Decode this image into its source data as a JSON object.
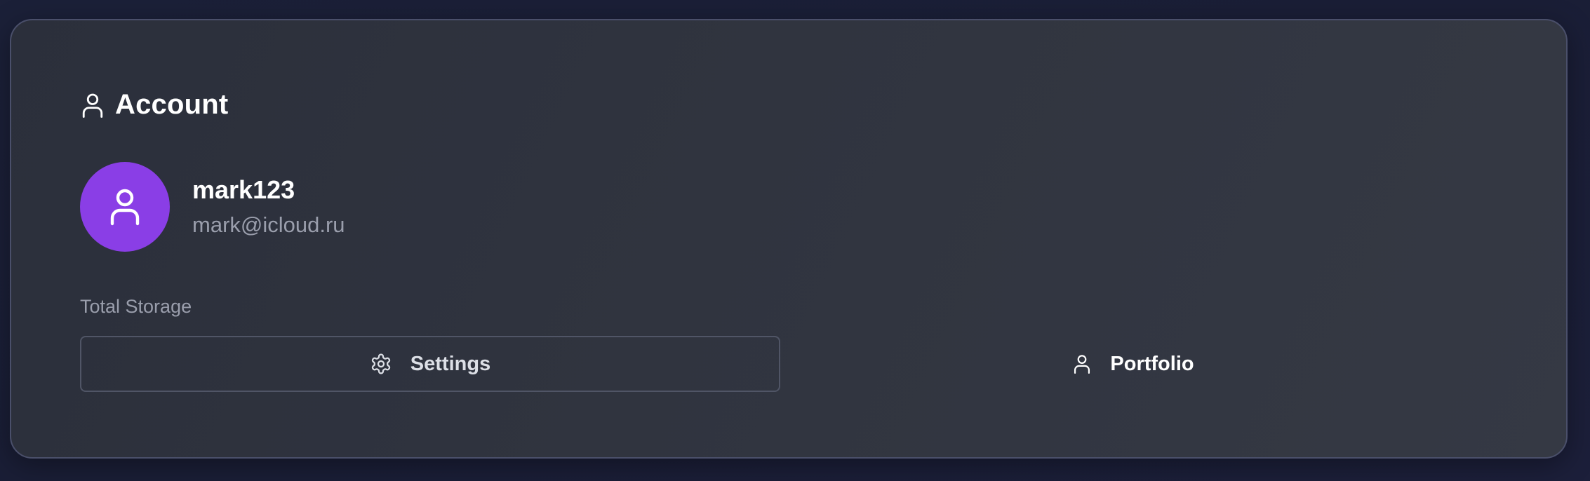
{
  "account_card": {
    "title": "Account",
    "title_icon": "user-icon",
    "user": {
      "avatar_icon": "user-icon",
      "avatar_color": "#8a3ee6",
      "username": "mark123",
      "email": "mark@icloud.ru"
    },
    "storage": {
      "label": "Total Storage"
    },
    "actions": {
      "settings": {
        "label": "Settings",
        "icon": "gear-icon"
      },
      "portfolio": {
        "label": "Portfolio",
        "icon": "user-icon"
      }
    }
  }
}
